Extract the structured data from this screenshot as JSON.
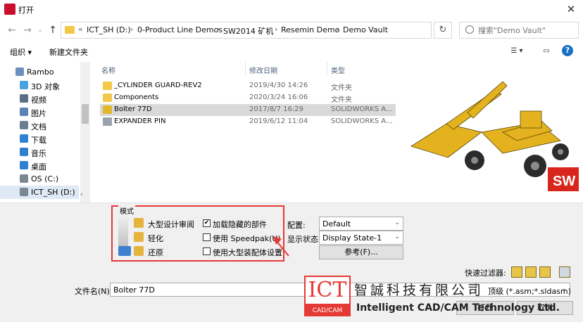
{
  "window": {
    "title": "打开"
  },
  "nav": {
    "path": [
      "ICT_SH (D:)",
      "0-Product Line Demos",
      "SW2014 矿机",
      "Resemin Demo",
      "Demo Vault"
    ],
    "overflow": "«",
    "search_placeholder": "搜索\"Demo Vault\""
  },
  "toolbar": {
    "organize": "组织 ▾",
    "new_folder": "新建文件夹"
  },
  "sidebar": {
    "items": [
      {
        "label": "Rambo",
        "icon": "user-icon",
        "color": "#6b8fbf"
      },
      {
        "label": "3D 对象",
        "icon": "cube-icon",
        "color": "#4aa3df"
      },
      {
        "label": "视频",
        "icon": "video-icon",
        "color": "#5b6f86"
      },
      {
        "label": "图片",
        "icon": "picture-icon",
        "color": "#5b83b5"
      },
      {
        "label": "文档",
        "icon": "document-icon",
        "color": "#6a7f94"
      },
      {
        "label": "下载",
        "icon": "download-icon",
        "color": "#2f80d1"
      },
      {
        "label": "音乐",
        "icon": "music-icon",
        "color": "#2f80d1"
      },
      {
        "label": "桌面",
        "icon": "desktop-icon",
        "color": "#2f80d1"
      },
      {
        "label": "OS (C:)",
        "icon": "drive-icon",
        "color": "#7a8894"
      },
      {
        "label": "ICT_SH (D:)",
        "icon": "drive-icon",
        "color": "#7a8894"
      }
    ]
  },
  "files": {
    "headers": {
      "name": "名称",
      "date": "修改日期",
      "type": "类型"
    },
    "rows": [
      {
        "name": "_CYLINDER GUARD-REV2",
        "date": "2019/4/30 14:26",
        "type": "文件夹",
        "icon": "folder-icon",
        "color": "#f2c84b"
      },
      {
        "name": "Components",
        "date": "2020/3/24 16:06",
        "type": "文件夹",
        "icon": "folder-icon",
        "color": "#f2c84b"
      },
      {
        "name": "Bolter 77D",
        "date": "2017/8/7 16:29",
        "type": "SOLIDWORKS A...",
        "icon": "assembly-icon",
        "color": "#e2b72b"
      },
      {
        "name": "EXPANDER PIN",
        "date": "2019/6/12 11:04",
        "type": "SOLIDWORKS A...",
        "icon": "assembly-icon",
        "color": "#9aa3ad"
      }
    ]
  },
  "modes": {
    "legend": "模式",
    "large_review": "大型设计审阅",
    "lightweight": "轻化",
    "resolved": "还原",
    "load_hidden": "加载隐藏的部件",
    "use_speedpak": "使用 Speedpak(U)",
    "use_large_assembly": "使用大型装配体设置"
  },
  "config": {
    "config_label": "配置:",
    "config_value": "Default",
    "display_label": "显示状态:",
    "display_value": "Display State-1",
    "reference_button": "参考(F)..."
  },
  "filter": {
    "label": "快速过滤器:"
  },
  "footer": {
    "filename_label": "文件名(N):",
    "filename_value": "Bolter 77D",
    "filetype_value": "顶级 (*.asm;*.sldasm)",
    "open_button": "打开",
    "cancel_button": "取消"
  },
  "watermark": {
    "logo_top": "ICT",
    "logo_bottom": "CAD/CAM",
    "chinese": "智誠科技有限公司",
    "english": "Intelligent CAD/CAM Technology Ltd."
  },
  "preview": {
    "badge": "SW"
  }
}
